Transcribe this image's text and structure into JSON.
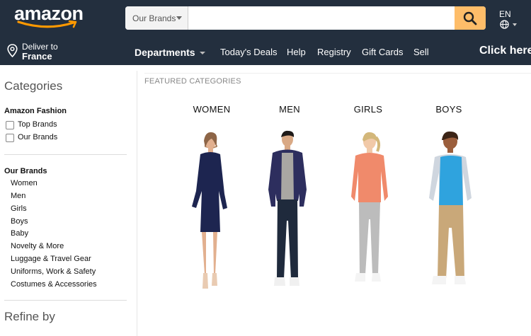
{
  "header": {
    "logo_text": "amazon",
    "search": {
      "scope_label": "Our Brands",
      "placeholder": "",
      "value": ""
    },
    "language": {
      "code": "EN"
    }
  },
  "nav": {
    "deliver_line1": "Deliver to",
    "deliver_line2": "France",
    "departments_label": "Departments",
    "items": [
      "Today's Deals",
      "Help",
      "Registry",
      "Gift Cards",
      "Sell"
    ],
    "promo_label": "Click here"
  },
  "sidebar": {
    "title": "Categories",
    "fashion_heading": "Amazon Fashion",
    "filters": [
      {
        "label": "Top Brands",
        "checked": false
      },
      {
        "label": "Our Brands",
        "checked": false
      }
    ],
    "brands_heading": "Our Brands",
    "brand_links": [
      "Women",
      "Men",
      "Girls",
      "Boys",
      "Baby",
      "Novelty & More",
      "Luggage & Travel Gear",
      "Uniforms, Work & Safety",
      "Costumes & Accessories"
    ],
    "refine_title": "Refine by"
  },
  "main": {
    "section_label": "FEATURED CATEGORIES",
    "categories": [
      {
        "label": "WOMEN"
      },
      {
        "label": "MEN"
      },
      {
        "label": "GIRLS"
      },
      {
        "label": "BOYS"
      }
    ]
  },
  "colors": {
    "header_bg": "#232f3e",
    "search_button": "#febd69",
    "logo_smile": "#ff9900"
  },
  "icons": {
    "search": "search-icon",
    "globe": "globe-icon",
    "location": "location-pin-icon"
  }
}
